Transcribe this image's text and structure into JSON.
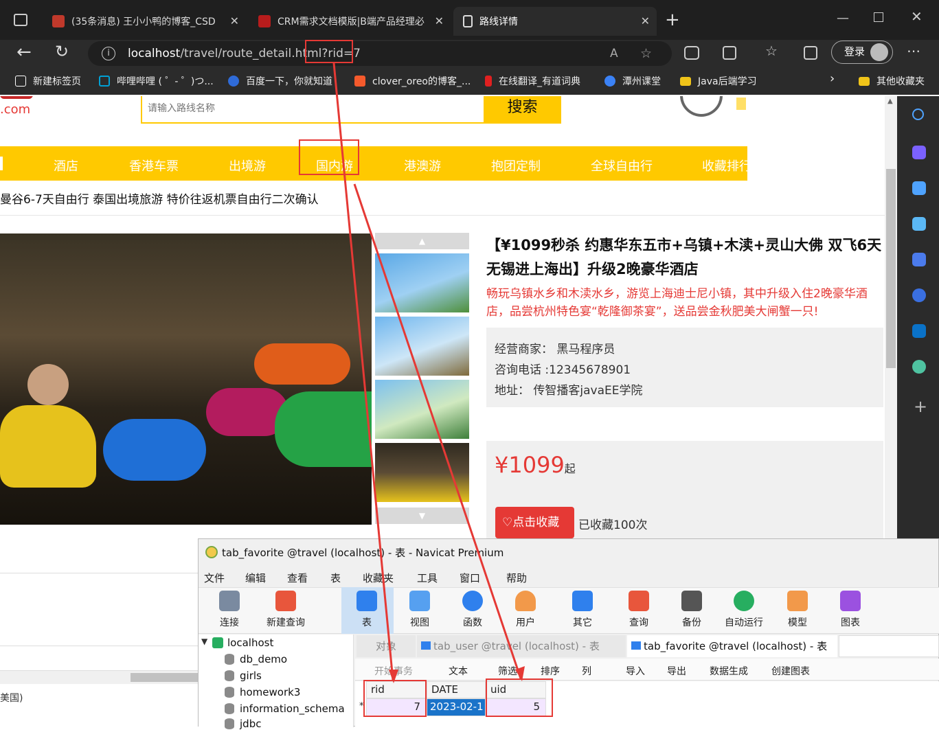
{
  "browser": {
    "tabs": [
      {
        "title": "(35条消息) 王小小鸭的博客_CSD",
        "icon_color": "#c0392b"
      },
      {
        "title": "CRM需求文档模版|B端产品经理必",
        "icon_color": "#b71c1c"
      },
      {
        "title": "路线详情",
        "icon": "page-icon"
      }
    ],
    "url_host": "localhost",
    "url_path": "/travel/route_detail.html?rid=7",
    "login_label": "登录",
    "bookmarks": [
      {
        "label": "新建标签页",
        "color": "#ffffff"
      },
      {
        "label": "哔哩哔哩 ( ゜- ゜)つ...",
        "color": "#00a1d6"
      },
      {
        "label": "百度一下，你就知道",
        "color": "#2f6bd8"
      },
      {
        "label": "clover_oreo的博客_...",
        "color": "#f55a2c"
      },
      {
        "label": "在线翻译_有道词典",
        "color": "#e02020"
      },
      {
        "label": "潭州课堂",
        "color": "#3b82f6"
      },
      {
        "label": "Java后端学习",
        "color": "#f0c419"
      },
      {
        "label": "其他收藏夹",
        "color": "#f0c419"
      }
    ]
  },
  "site": {
    "logo_suffix": ".com",
    "search_placeholder": "请输入路线名称",
    "search_button": "搜索",
    "nav": [
      "酒店",
      "香港车票",
      "出境游",
      "国内游",
      "港澳游",
      "抱团定制",
      "全球自由行",
      "收藏排行"
    ],
    "breadcrumb_title": "曼谷6-7天自由行 泰国出境旅游 特价往返机票自由行二次确认",
    "route": {
      "title": "【¥1099秒杀 约惠华东五市+乌镇+木渎+灵山大佛 双飞6天 无锡进上海出】升级2晚豪华酒店",
      "subtitle": "畅玩乌镇水乡和木渎水乡，游览上海迪士尼小镇，其中升级入住2晚豪华酒店，品尝杭州特色宴“乾隆御茶宴”，送品尝金秋肥美大闸蟹一只!",
      "seller": "经营商家： 黑马程序员",
      "phone": "咨询电话 :12345678901",
      "address": "地址： 传智播客javaEE学院",
      "price": "¥1099",
      "price_suffix": "起",
      "fav_button": "点击收藏",
      "fav_count": "已收藏100次"
    },
    "footer_fragment": "美国)"
  },
  "navicat": {
    "title": "tab_favorite @travel (localhost) - 表 - Navicat Premium",
    "menu": [
      "文件",
      "编辑",
      "查看",
      "表",
      "收藏夹",
      "工具",
      "窗口",
      "帮助"
    ],
    "toolbar": [
      {
        "label": "连接",
        "color": "#7a8aa0"
      },
      {
        "label": "新建查询",
        "color": "#e8563c"
      },
      {
        "label": "表",
        "color": "#2f80ed"
      },
      {
        "label": "视图",
        "color": "#2f80ed"
      },
      {
        "label": "函数",
        "color": "#2f80ed"
      },
      {
        "label": "用户",
        "color": "#f2994a"
      },
      {
        "label": "其它",
        "color": "#2f80ed"
      },
      {
        "label": "查询",
        "color": "#e8563c"
      },
      {
        "label": "备份",
        "color": "#555555"
      },
      {
        "label": "自动运行",
        "color": "#27ae60"
      },
      {
        "label": "模型",
        "color": "#f2994a"
      },
      {
        "label": "图表",
        "color": "#9b51e0"
      }
    ],
    "tree": [
      "localhost",
      "db_demo",
      "girls",
      "homework3",
      "information_schema",
      "jdbc"
    ],
    "tabs": [
      "对象",
      "tab_user @travel (localhost) - 表",
      "tab_favorite @travel (localhost) - 表"
    ],
    "subtoolbar": [
      "开始事务",
      "文本",
      "筛选",
      "排序",
      "列",
      "导入",
      "导出",
      "数据生成",
      "创建图表"
    ],
    "table": {
      "columns": [
        "rid",
        "DATE",
        "uid"
      ],
      "rows": [
        [
          "7",
          "2023-02-1",
          "5"
        ]
      ],
      "row_marker": "*"
    }
  }
}
